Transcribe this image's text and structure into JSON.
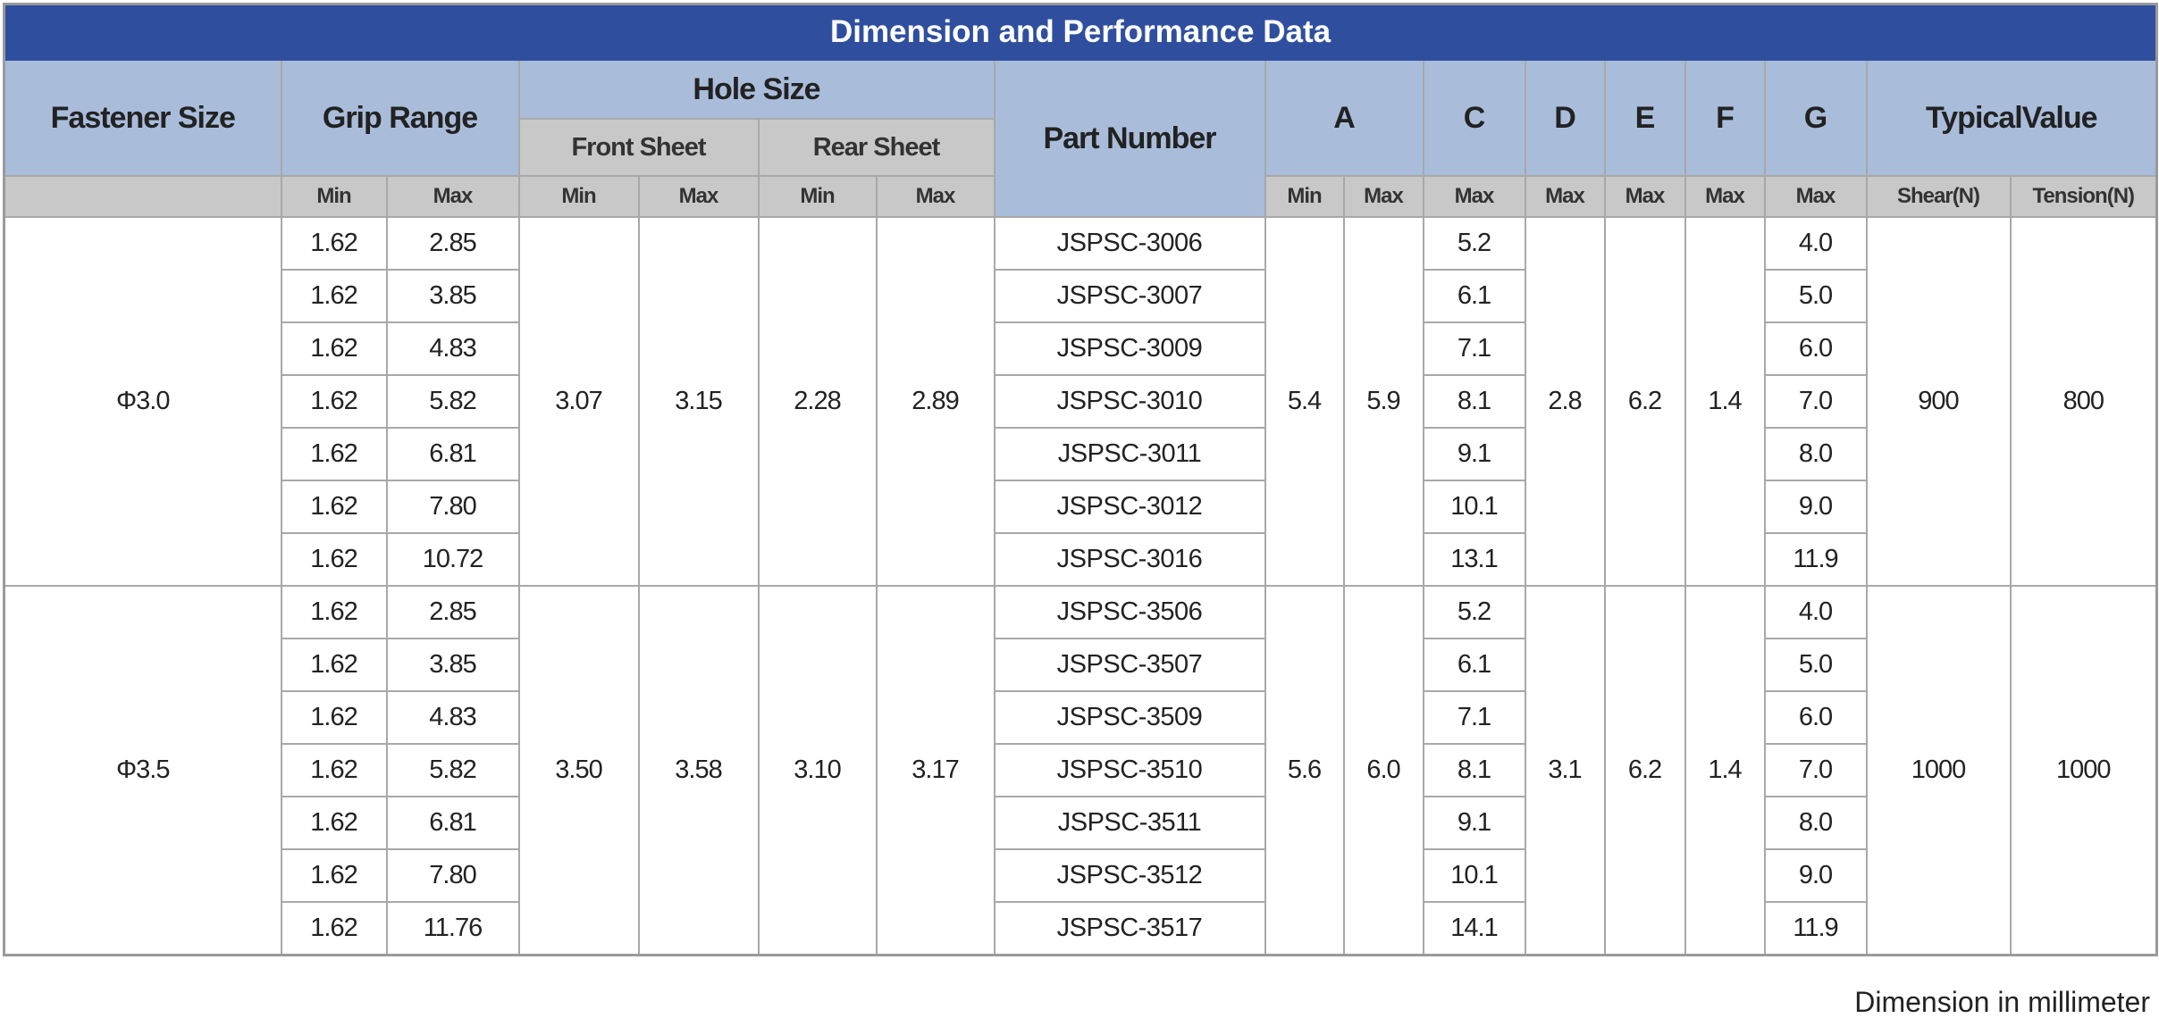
{
  "title": "Dimension and Performance Data",
  "headers": {
    "fastener_size": "Fastener Size",
    "grip_range": "Grip Range",
    "hole_size": "Hole Size",
    "front_sheet": "Front Sheet",
    "rear_sheet": "Rear Sheet",
    "part_number": "Part Number",
    "a": "A",
    "c": "C",
    "d": "D",
    "e": "E",
    "f": "F",
    "g": "G",
    "typical_value": "TypicalValue"
  },
  "units": [
    "Min",
    "Max",
    "Min",
    "Max",
    "Min",
    "Max",
    "Min",
    "Max",
    "Max",
    "Max",
    "Max",
    "Max",
    "Max",
    "Shear(N)",
    "Tension(N)"
  ],
  "groups": [
    {
      "size": "Φ3.0",
      "front_min": "3.07",
      "front_max": "3.15",
      "rear_min": "2.28",
      "rear_max": "2.89",
      "a_min": "5.4",
      "a_max": "5.9",
      "d": "2.8",
      "e": "6.2",
      "f": "1.4",
      "shear": "900",
      "tension": "800",
      "rows": [
        {
          "grip_min": "1.62",
          "grip_max": "2.85",
          "part": "JSPSC-3006",
          "c": "5.2",
          "g": "4.0"
        },
        {
          "grip_min": "1.62",
          "grip_max": "3.85",
          "part": "JSPSC-3007",
          "c": "6.1",
          "g": "5.0"
        },
        {
          "grip_min": "1.62",
          "grip_max": "4.83",
          "part": "JSPSC-3009",
          "c": "7.1",
          "g": "6.0"
        },
        {
          "grip_min": "1.62",
          "grip_max": "5.82",
          "part": "JSPSC-3010",
          "c": "8.1",
          "g": "7.0"
        },
        {
          "grip_min": "1.62",
          "grip_max": "6.81",
          "part": "JSPSC-3011",
          "c": "9.1",
          "g": "8.0"
        },
        {
          "grip_min": "1.62",
          "grip_max": "7.80",
          "part": "JSPSC-3012",
          "c": "10.1",
          "g": "9.0"
        },
        {
          "grip_min": "1.62",
          "grip_max": "10.72",
          "part": "JSPSC-3016",
          "c": "13.1",
          "g": "11.9"
        }
      ]
    },
    {
      "size": "Φ3.5",
      "front_min": "3.50",
      "front_max": "3.58",
      "rear_min": "3.10",
      "rear_max": "3.17",
      "a_min": "5.6",
      "a_max": "6.0",
      "d": "3.1",
      "e": "6.2",
      "f": "1.4",
      "shear": "1000",
      "tension": "1000",
      "rows": [
        {
          "grip_min": "1.62",
          "grip_max": "2.85",
          "part": "JSPSC-3506",
          "c": "5.2",
          "g": "4.0"
        },
        {
          "grip_min": "1.62",
          "grip_max": "3.85",
          "part": "JSPSC-3507",
          "c": "6.1",
          "g": "5.0"
        },
        {
          "grip_min": "1.62",
          "grip_max": "4.83",
          "part": "JSPSC-3509",
          "c": "7.1",
          "g": "6.0"
        },
        {
          "grip_min": "1.62",
          "grip_max": "5.82",
          "part": "JSPSC-3510",
          "c": "8.1",
          "g": "7.0"
        },
        {
          "grip_min": "1.62",
          "grip_max": "6.81",
          "part": "JSPSC-3511",
          "c": "9.1",
          "g": "8.0"
        },
        {
          "grip_min": "1.62",
          "grip_max": "7.80",
          "part": "JSPSC-3512",
          "c": "10.1",
          "g": "9.0"
        },
        {
          "grip_min": "1.62",
          "grip_max": "11.76",
          "part": "JSPSC-3517",
          "c": "14.1",
          "g": "11.9"
        }
      ]
    }
  ],
  "footnote": "Dimension in millimeter",
  "colors": {
    "title_bg": "#2f4f9e",
    "header_bg": "#a9bddb",
    "subheader_bg": "#c8c8c8",
    "border": "#a8a8a8"
  }
}
